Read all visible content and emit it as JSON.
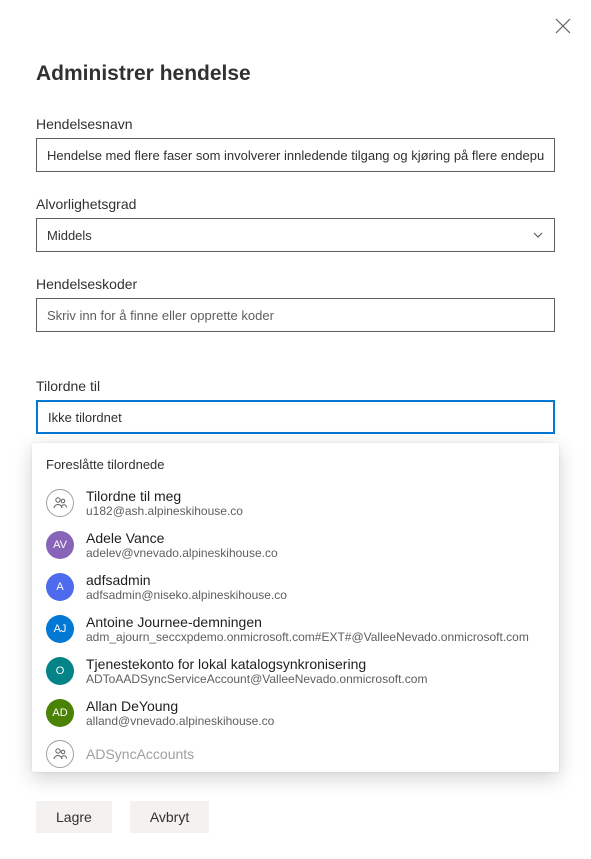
{
  "header": {
    "title": "Administrer hendelse"
  },
  "fields": {
    "name": {
      "label": "Hendelsesnavn",
      "value": "Hendelse med flere faser som involverer innledende tilgang og kjøring på flere endepunkter"
    },
    "severity": {
      "label": "Alvorlighetsgrad",
      "value": "Middels"
    },
    "tags": {
      "label": "Hendelseskoder",
      "placeholder": "Skriv inn for å finne eller opprette koder"
    },
    "assign": {
      "label": "Tilordne til",
      "value": "Ikke tilordnet"
    }
  },
  "dropdown": {
    "header": "Foreslåtte tilordnede",
    "suggestions": [
      {
        "name": "Tilordne til meg",
        "email": "u182@ash.alpineskihouse.co",
        "initials": "",
        "color": "",
        "icon": "people"
      },
      {
        "name": "Adele Vance",
        "email": "adelev@vnevado.alpineskihouse.co",
        "initials": "AV",
        "color": "#8764b8"
      },
      {
        "name": "adfsadmin",
        "email": "adfsadmin@niseko.alpineskihouse.co",
        "initials": "A",
        "color": "#4f6bed"
      },
      {
        "name": "Antoine Journee-demningen",
        "email": "adm_ajourn_seccxpdemo.onmicrosoft.com#EXT#@ValleeNevado.onmicrosoft.com",
        "initials": "AJ",
        "color": "#0078d4"
      },
      {
        "name": "Tjenestekonto for lokal katalogsynkronisering",
        "email": "ADToAADSyncServiceAccount@ValleeNevado.onmicrosoft.com",
        "initials": "O",
        "color": "#038387"
      },
      {
        "name": "Allan DeYoung",
        "email": "alland@vnevado.alpineskihouse.co",
        "initials": "AD",
        "color": "#498205"
      }
    ],
    "partial": {
      "name": "ADSyncAccounts"
    }
  },
  "actions": {
    "save": "Lagre",
    "cancel": "Avbryt"
  }
}
